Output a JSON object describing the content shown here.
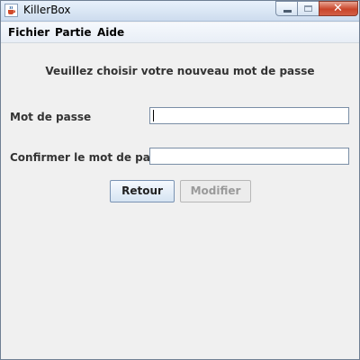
{
  "window": {
    "title": "KillerBox",
    "close_glyph": "✕"
  },
  "menu": {
    "items": [
      "Fichier",
      "Partie",
      "Aide"
    ]
  },
  "form": {
    "prompt": "Veuillez choisir votre nouveau mot de passe",
    "password_label": "Mot de passe",
    "password_value": "",
    "confirm_label": "Confirmer le mot de passe",
    "confirm_value": ""
  },
  "buttons": {
    "back_label": "Retour",
    "modify_label": "Modifier",
    "modify_enabled": false
  },
  "icons": {
    "app": "java-cup-icon",
    "minimize": "minimize-icon",
    "maximize": "maximize-icon",
    "close": "close-icon"
  }
}
